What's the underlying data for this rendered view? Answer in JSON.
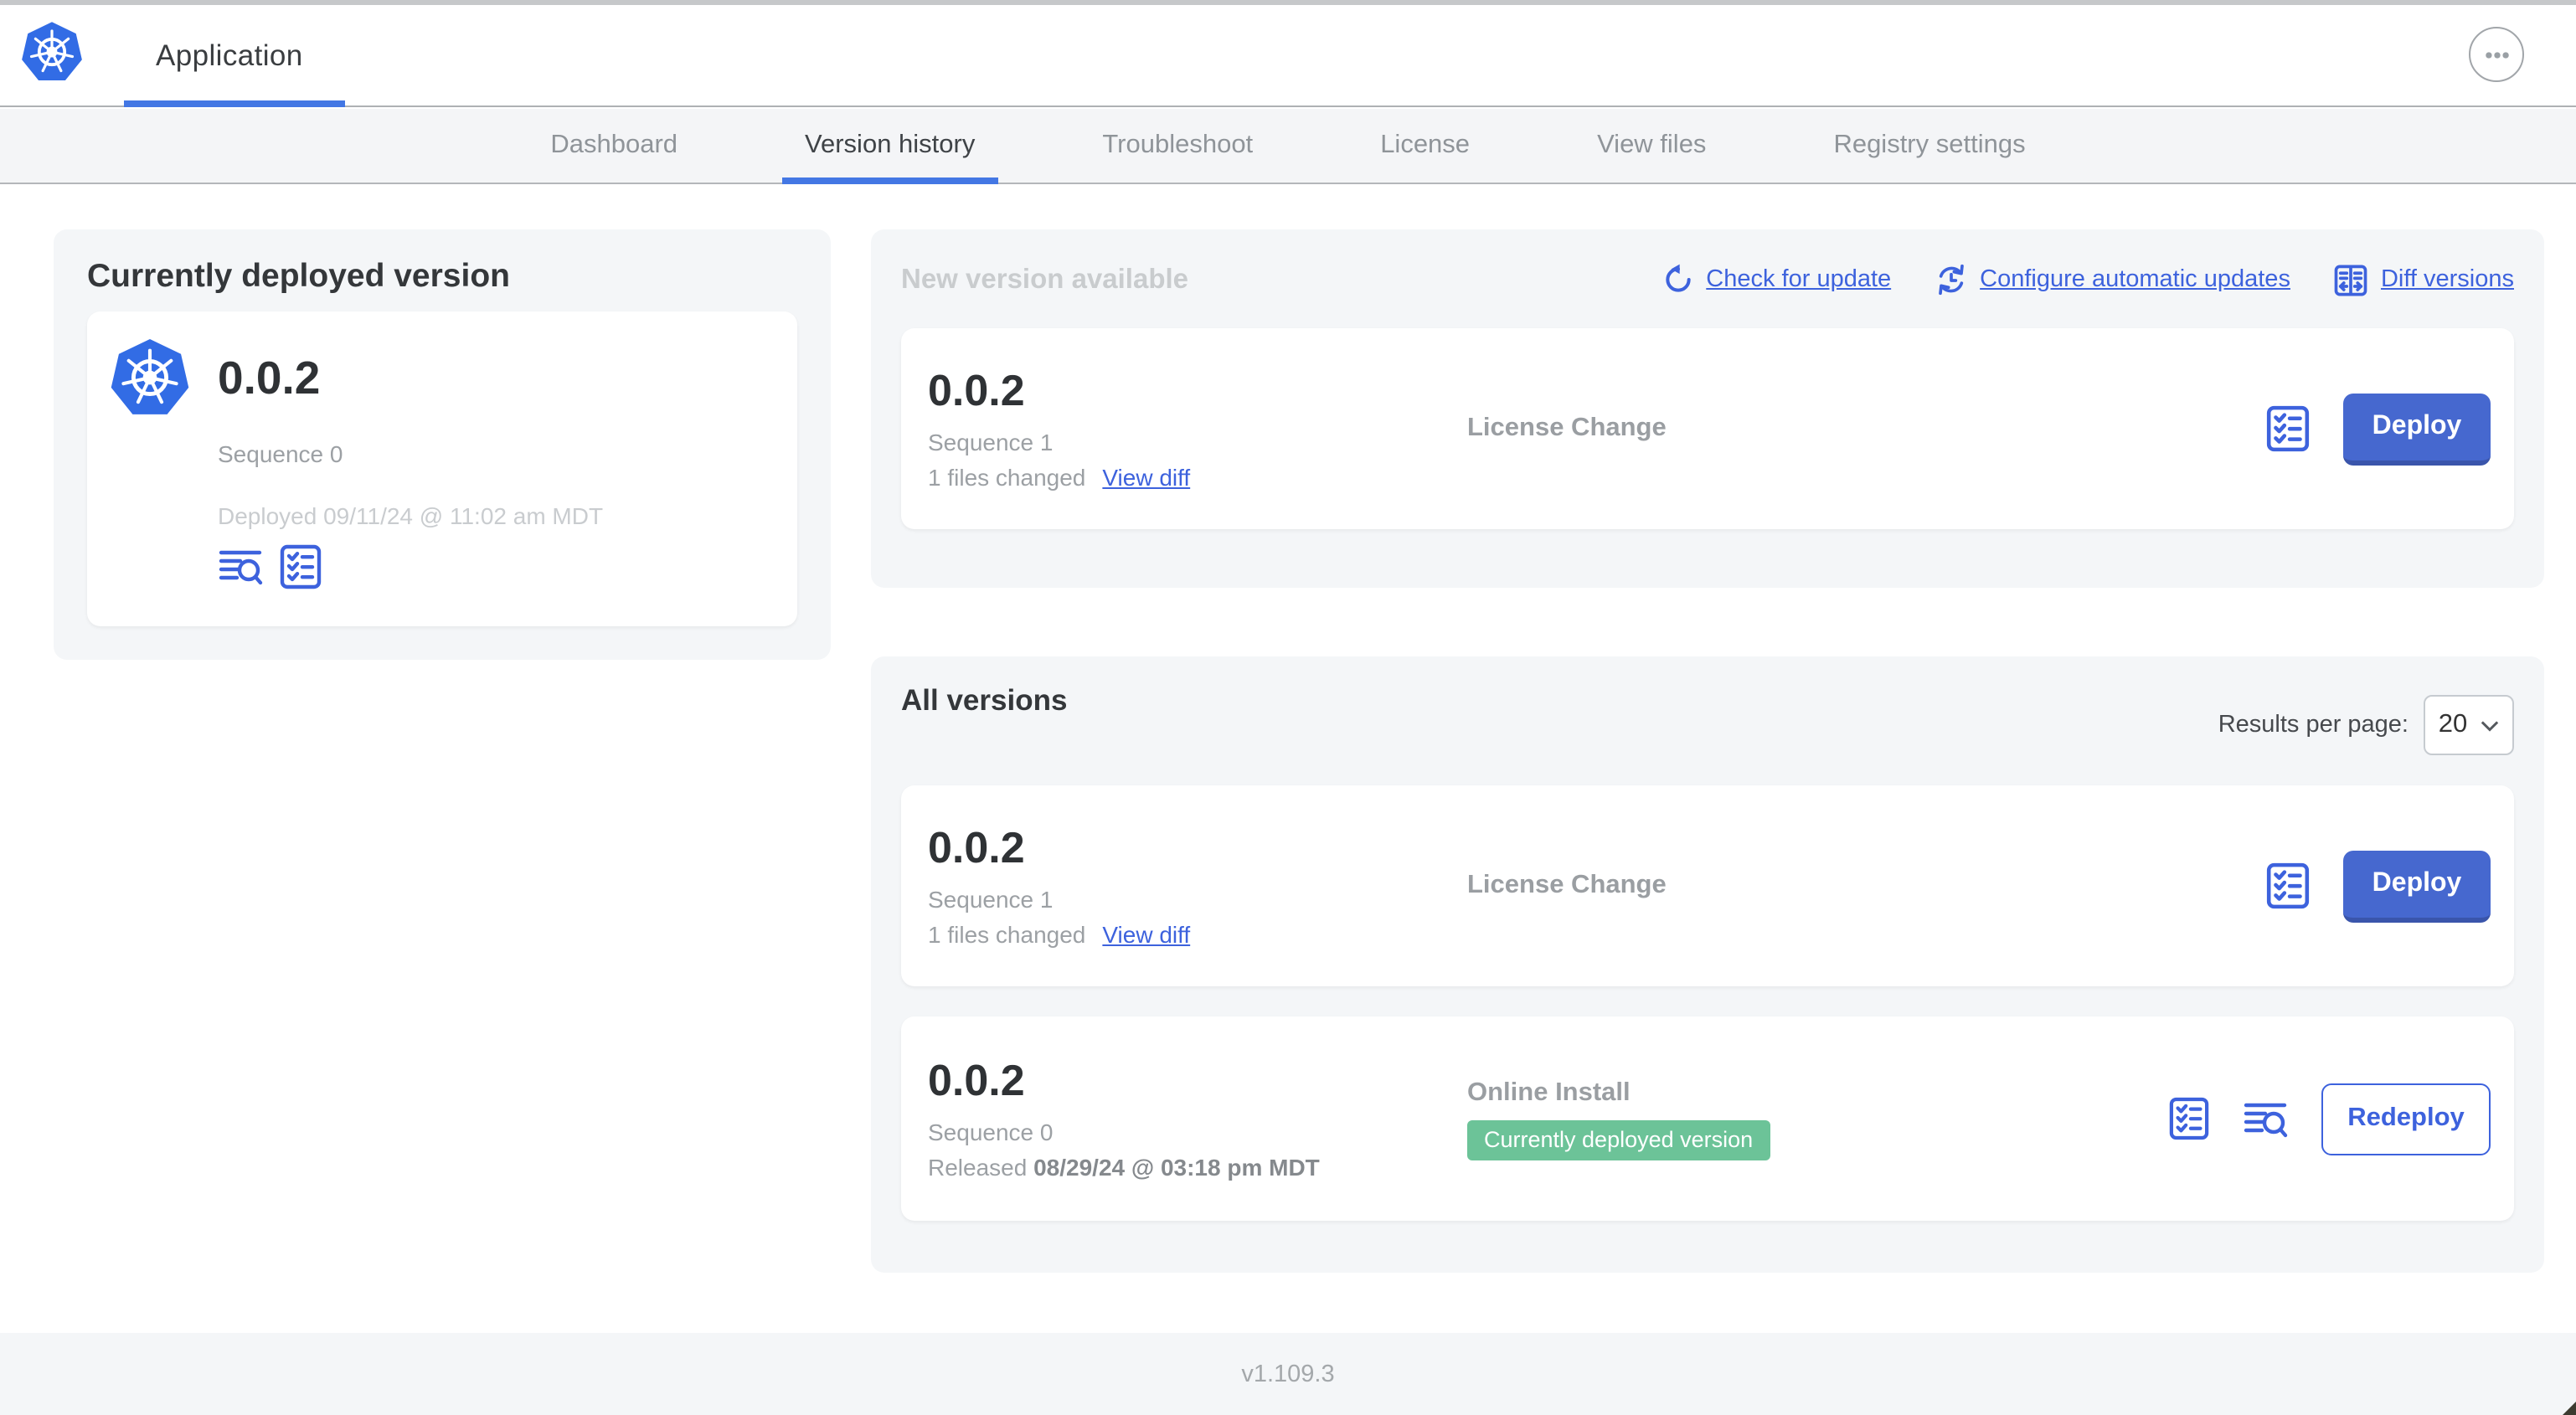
{
  "header": {
    "app_title": "Application"
  },
  "nav": {
    "tabs": [
      "Dashboard",
      "Version history",
      "Troubleshoot",
      "License",
      "View files",
      "Registry settings"
    ],
    "active_tab": "Version history"
  },
  "current_version_panel": {
    "title": "Currently deployed version",
    "version": "0.0.2",
    "sequence": "Sequence 0",
    "deployed": "Deployed 09/11/24 @ 11:02 am MDT"
  },
  "new_version_panel": {
    "title": "New version available",
    "actions": {
      "check_for_update": "Check for update",
      "configure_automatic_updates": "Configure automatic updates",
      "diff_versions": "Diff versions"
    },
    "card": {
      "version": "0.0.2",
      "sequence": "Sequence 1",
      "files_changed": "1 files changed",
      "view_diff": "View diff",
      "change_type": "License Change",
      "deploy": "Deploy"
    }
  },
  "all_versions_panel": {
    "title": "All versions",
    "results_per_page_label": "Results per page:",
    "results_per_page": "20",
    "rows": [
      {
        "version": "0.0.2",
        "sequence": "Sequence 1",
        "files_changed": "1 files changed",
        "view_diff": "View diff",
        "change_type": "License Change",
        "action": "Deploy"
      },
      {
        "version": "0.0.2",
        "sequence": "Sequence 0",
        "released_prefix": "Released",
        "released_date": "08/29/24 @ 03:18 pm MDT",
        "install_type": "Online Install",
        "badge": "Currently deployed version",
        "action": "Redeploy"
      }
    ]
  },
  "footer": {
    "version": "v1.109.3"
  },
  "icons": {
    "logo": "kubernetes-logo",
    "more": "ellipsis-icon",
    "check_for_update": "refresh-icon",
    "configure_automatic_updates": "sync-clock-icon",
    "diff_versions": "diff-columns-icon",
    "preflight": "checklist-icon",
    "logs": "view-logs-icon",
    "select": "chevron-down-icon"
  },
  "colors": {
    "link_blue": "#3d62dd",
    "button_blue": "#4668cf",
    "logo_blue": "#326ce5",
    "underline_blue": "#4377e4",
    "badge_green": "#6cc398",
    "panel_gray": "#f4f6f8"
  }
}
